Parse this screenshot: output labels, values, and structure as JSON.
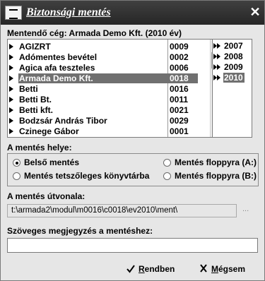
{
  "window": {
    "title": "Biztonsági mentés",
    "close": "✕"
  },
  "company_label": "Mentendő cég: Armada Demo Kft. (2010 év)",
  "companies": [
    {
      "name": "AGIZRT",
      "code": "0009",
      "selected": false
    },
    {
      "name": "Adómentes bevétel",
      "code": "0002",
      "selected": false
    },
    {
      "name": "Agica afa teszteles",
      "code": "0006",
      "selected": false
    },
    {
      "name": "Armada Demo Kft.",
      "code": "0018",
      "selected": true
    },
    {
      "name": "Betti",
      "code": "0016",
      "selected": false
    },
    {
      "name": "Betti Bt.",
      "code": "0011",
      "selected": false
    },
    {
      "name": "Betti kft.",
      "code": "0021",
      "selected": false
    },
    {
      "name": "Bodzsár András Tibor",
      "code": "0029",
      "selected": false
    },
    {
      "name": "Czinege Gábor",
      "code": "0001",
      "selected": false
    }
  ],
  "years": [
    {
      "label": "2007",
      "selected": false
    },
    {
      "label": "2008",
      "selected": false
    },
    {
      "label": "2009",
      "selected": false
    },
    {
      "label": "2010",
      "selected": true
    }
  ],
  "location": {
    "label": "A mentés helye:",
    "options": {
      "internal": {
        "label": "Belső mentés",
        "checked": true
      },
      "custom_dir": {
        "label": "Mentés tetszőleges könyvtárba",
        "checked": false
      },
      "floppy_a": {
        "label": "Mentés floppyra (A:)",
        "checked": false
      },
      "floppy_b": {
        "label": "Mentés floppyra (B:)",
        "checked": false
      }
    }
  },
  "path": {
    "label": "A mentés útvonala:",
    "value": "t:\\armada2\\modul\\m0016\\c0018\\ev2010\\ment\\",
    "browse": "..."
  },
  "note": {
    "label": "Szöveges megjegyzés a mentéshez:",
    "value": ""
  },
  "buttons": {
    "ok": "Rendben",
    "cancel": "Mégsem"
  }
}
